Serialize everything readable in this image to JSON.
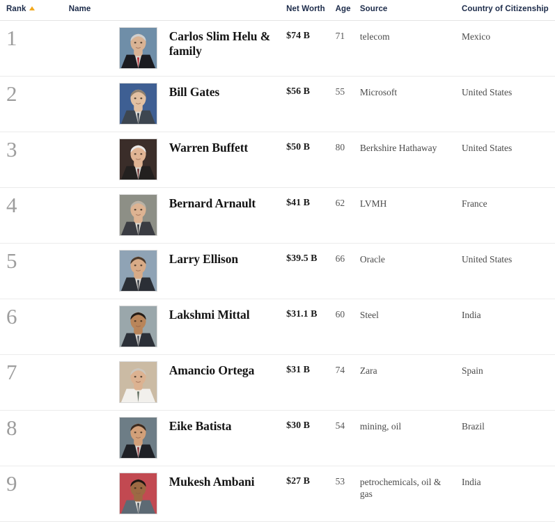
{
  "table": {
    "sort_indicator": "ascending-triangle",
    "sort_color": "#f2a81d",
    "columns": {
      "rank": "Rank",
      "name": "Name",
      "net_worth": "Net Worth",
      "age": "Age",
      "source": "Source",
      "country": "Country of Citizenship"
    },
    "rows": [
      {
        "rank": "1",
        "name": "Carlos Slim Helu & family",
        "net_worth": "$74 B",
        "age": "71",
        "source": "telecom",
        "country": "Mexico",
        "photo": "portrait-carlos-slim-helu"
      },
      {
        "rank": "2",
        "name": "Bill Gates",
        "net_worth": "$56 B",
        "age": "55",
        "source": "Microsoft",
        "country": "United States",
        "photo": "portrait-bill-gates"
      },
      {
        "rank": "3",
        "name": "Warren Buffett",
        "net_worth": "$50 B",
        "age": "80",
        "source": "Berkshire Hathaway",
        "country": "United States",
        "photo": "portrait-warren-buffett"
      },
      {
        "rank": "4",
        "name": "Bernard Arnault",
        "net_worth": "$41 B",
        "age": "62",
        "source": "LVMH",
        "country": "France",
        "photo": "portrait-bernard-arnault"
      },
      {
        "rank": "5",
        "name": "Larry Ellison",
        "net_worth": "$39.5 B",
        "age": "66",
        "source": "Oracle",
        "country": "United States",
        "photo": "portrait-larry-ellison"
      },
      {
        "rank": "6",
        "name": "Lakshmi Mittal",
        "net_worth": "$31.1 B",
        "age": "60",
        "source": "Steel",
        "country": "India",
        "photo": "portrait-lakshmi-mittal"
      },
      {
        "rank": "7",
        "name": "Amancio Ortega",
        "net_worth": "$31 B",
        "age": "74",
        "source": "Zara",
        "country": "Spain",
        "photo": "portrait-amancio-ortega"
      },
      {
        "rank": "8",
        "name": "Eike Batista",
        "net_worth": "$30 B",
        "age": "54",
        "source": "mining, oil",
        "country": "Brazil",
        "photo": "portrait-eike-batista"
      },
      {
        "rank": "9",
        "name": "Mukesh Ambani",
        "net_worth": "$27 B",
        "age": "53",
        "source": "petrochemicals, oil & gas",
        "country": "India",
        "photo": "portrait-mukesh-ambani"
      }
    ]
  }
}
